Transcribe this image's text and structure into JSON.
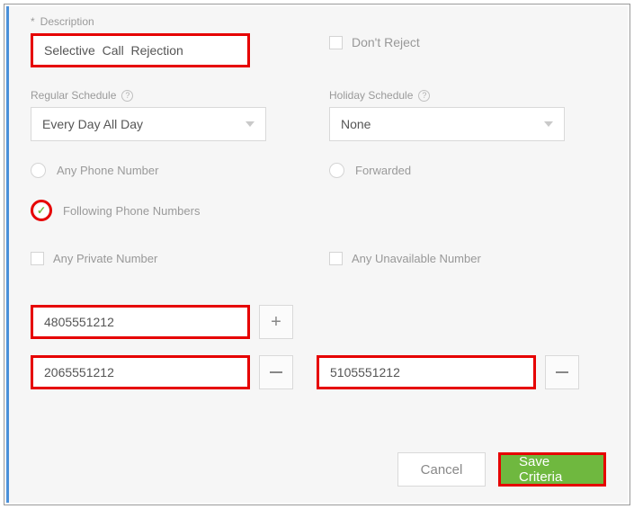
{
  "description": {
    "label": "Description",
    "value": "Selective  Call  Rejection"
  },
  "dont_reject_label": "Don't Reject",
  "schedule": {
    "regular_label": "Regular Schedule",
    "regular_value": "Every Day All Day",
    "holiday_label": "Holiday Schedule",
    "holiday_value": "None"
  },
  "options": {
    "any_phone": "Any Phone Number",
    "forwarded": "Forwarded",
    "following": "Following Phone Numbers",
    "any_private": "Any Private Number",
    "any_unavailable": "Any Unavailable Number"
  },
  "phone_numbers": [
    "4805551212",
    "2065551212",
    "5105551212"
  ],
  "buttons": {
    "cancel": "Cancel",
    "save": "Save Criteria"
  }
}
